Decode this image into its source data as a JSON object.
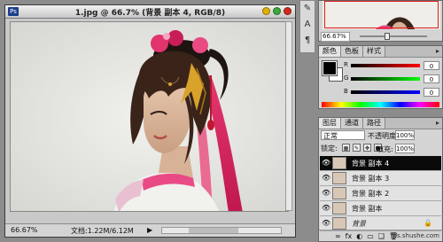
{
  "document": {
    "ps_badge": "Ps",
    "title": "1.jpg @ 66.7% (背景 副本 4, RGB/8)",
    "zoom": "66.67%",
    "doc_size": "文档:1.22M/6.12M",
    "status_arrow": "▶"
  },
  "toolstrip": {
    "tools": [
      {
        "name": "history-brush-icon",
        "glyph": "✎"
      },
      {
        "name": "type-tool-icon",
        "glyph": "A"
      },
      {
        "name": "paragraph-icon",
        "glyph": "¶"
      }
    ]
  },
  "navigator": {
    "zoom": "66.67%"
  },
  "color_panel": {
    "tabs": [
      "颜色",
      "色板",
      "样式"
    ],
    "active_tab": 0,
    "menu_glyph": "▸",
    "sliders": [
      {
        "label": "R",
        "value": "0",
        "gradient": "linear-gradient(to right,#000,#f00)"
      },
      {
        "label": "G",
        "value": "0",
        "gradient": "linear-gradient(to right,#000,#0f0)"
      },
      {
        "label": "B",
        "value": "0",
        "gradient": "linear-gradient(to right,#000,#00f)"
      }
    ]
  },
  "layers_panel": {
    "tabs": [
      "图层",
      "通道",
      "路径"
    ],
    "active_tab": 0,
    "menu_glyph": "▸",
    "blend_mode": "正常",
    "opacity_label": "不透明度:",
    "opacity": "100%",
    "lock_label": "锁定:",
    "fill_label": "填充:",
    "fill": "100%",
    "layers": [
      {
        "name": "背景 副本 4",
        "active": true,
        "visible": true
      },
      {
        "name": "背景 副本 3",
        "active": false,
        "visible": true
      },
      {
        "name": "背景 副本 2",
        "active": false,
        "visible": true
      },
      {
        "name": "背景 副本",
        "active": false,
        "visible": true
      },
      {
        "name": "背景",
        "active": false,
        "visible": true,
        "locked": true
      }
    ],
    "footer_glyphs": [
      "∞",
      "fx",
      "◐",
      "▭",
      "❑",
      "🗑"
    ],
    "watermark": "ps.shushe.com"
  },
  "colors": {
    "accent": "#000000"
  }
}
